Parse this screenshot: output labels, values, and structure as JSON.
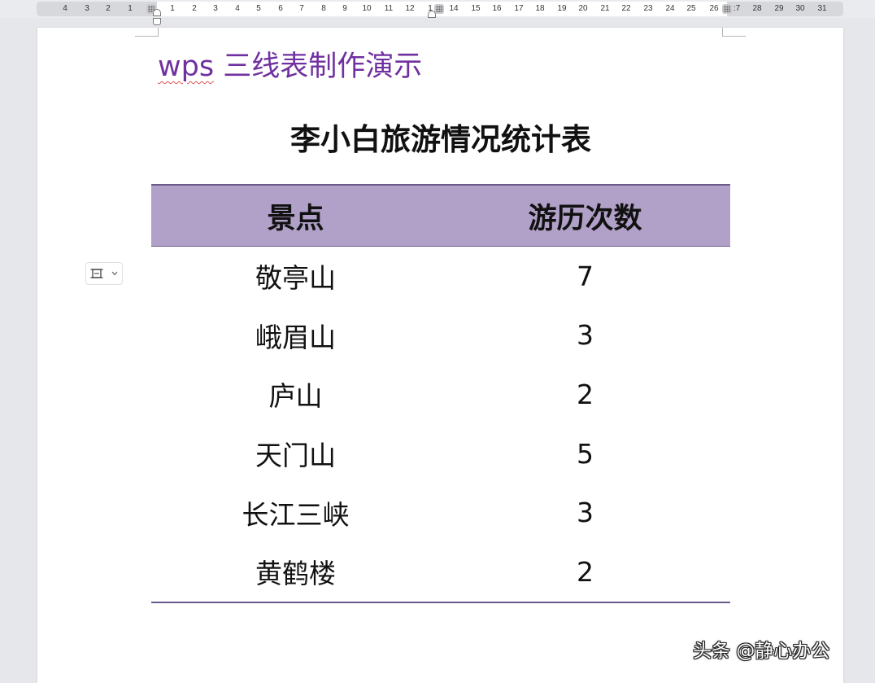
{
  "ruler": {
    "left_numbers": [
      "4",
      "3",
      "2",
      "1"
    ],
    "right_numbers": [
      "1",
      "2",
      "3",
      "4",
      "5",
      "6",
      "7",
      "8",
      "9",
      "10",
      "11",
      "12",
      "1",
      "14",
      "15",
      "16",
      "17",
      "18",
      "19",
      "20",
      "21",
      "22",
      "23",
      "24",
      "25",
      "26",
      ":7",
      "28",
      "29",
      "30",
      "31"
    ]
  },
  "document": {
    "heading_prefix": "wps",
    "heading_rest": " 三线表制作演示",
    "heading_color": "#7030a0",
    "table_title": "李小白旅游情况统计表",
    "table": {
      "header_color": "#b1a0c7",
      "rule_color": "#6b5a8c",
      "headers": [
        "景点",
        "游历次数"
      ],
      "rows": [
        [
          "敬亭山",
          "7"
        ],
        [
          "峨眉山",
          "3"
        ],
        [
          "庐山",
          "2"
        ],
        [
          "天门山",
          "5"
        ],
        [
          "长江三峡",
          "3"
        ],
        [
          "黄鹤楼",
          "2"
        ]
      ]
    }
  },
  "table_handle": {
    "icon": "table-layout-icon",
    "dropdown_icon": "chevron-down-icon"
  },
  "watermark": {
    "text": "头条 @静心办公"
  }
}
